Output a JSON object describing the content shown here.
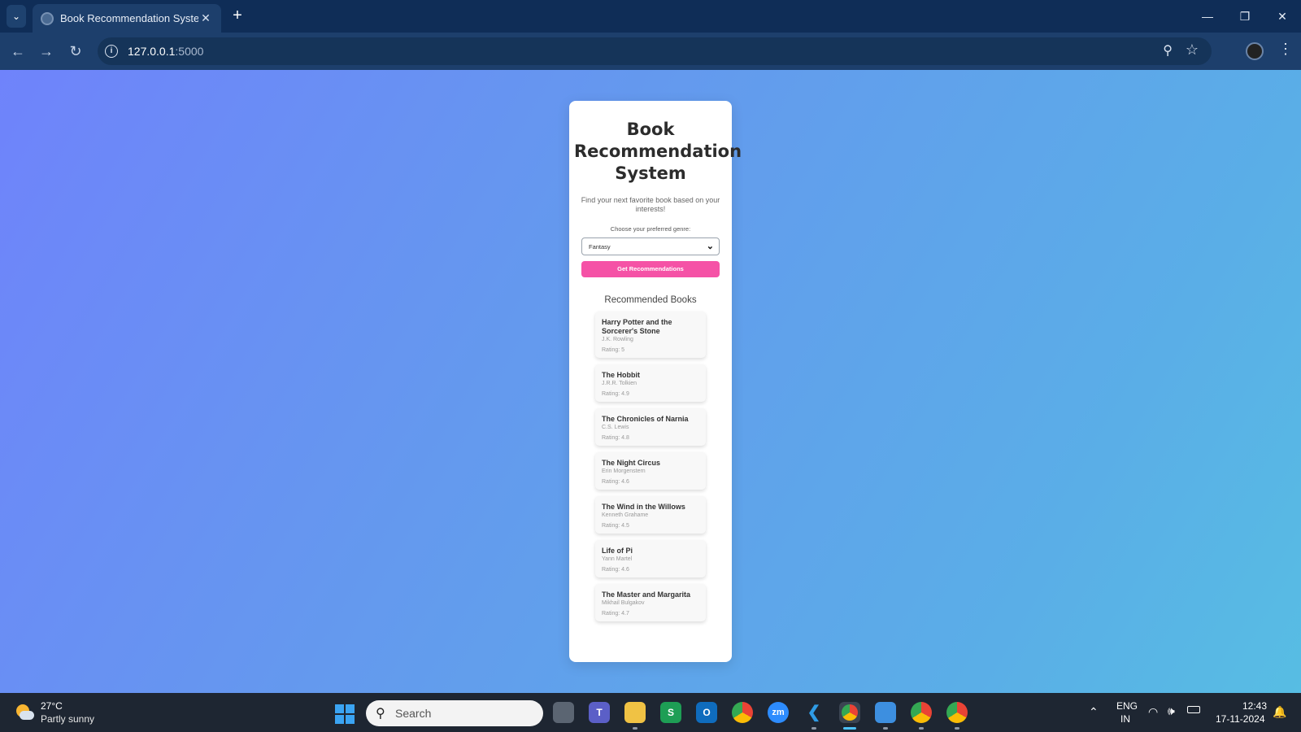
{
  "browser": {
    "tab_title": "Book Recommendation System",
    "tab_close": "✕",
    "new_tab": "+",
    "url_host": "127.0.0.1",
    "url_port": ":5000",
    "window_controls": [
      "—",
      "❐",
      "✕"
    ]
  },
  "page": {
    "title": "Book Recommendation System",
    "subtitle": "Find your next favorite book based on your interests!",
    "genre_label": "Choose your preferred genre:",
    "genre_selected": "Fantasy",
    "button_label": "Get Recommendations",
    "recommended_heading": "Recommended Books",
    "books": [
      {
        "title": "Harry Potter and the Sorcerer's Stone",
        "author": "J.K. Rowling",
        "rating": "Rating: 5"
      },
      {
        "title": "The Hobbit",
        "author": "J.R.R. Tolkien",
        "rating": "Rating: 4.9"
      },
      {
        "title": "The Chronicles of Narnia",
        "author": "C.S. Lewis",
        "rating": "Rating: 4.8"
      },
      {
        "title": "The Night Circus",
        "author": "Erin Morgenstern",
        "rating": "Rating: 4.6"
      },
      {
        "title": "The Wind in the Willows",
        "author": "Kenneth Grahame",
        "rating": "Rating: 4.5"
      },
      {
        "title": "Life of Pi",
        "author": "Yann Martel",
        "rating": "Rating: 4.6"
      },
      {
        "title": "The Master and Margarita",
        "author": "Mikhail Bulgakov",
        "rating": "Rating: 4.7"
      }
    ]
  },
  "taskbar": {
    "weather_temp": "27°C",
    "weather_condition": "Partly sunny",
    "search_placeholder": "Search",
    "language": "ENG",
    "region": "IN",
    "time": "12:43",
    "date": "17-11-2024"
  },
  "colors": {
    "accent_button": "#f552a6",
    "chrome_dark": "#0f2d57",
    "taskbar": "#1e2632"
  }
}
